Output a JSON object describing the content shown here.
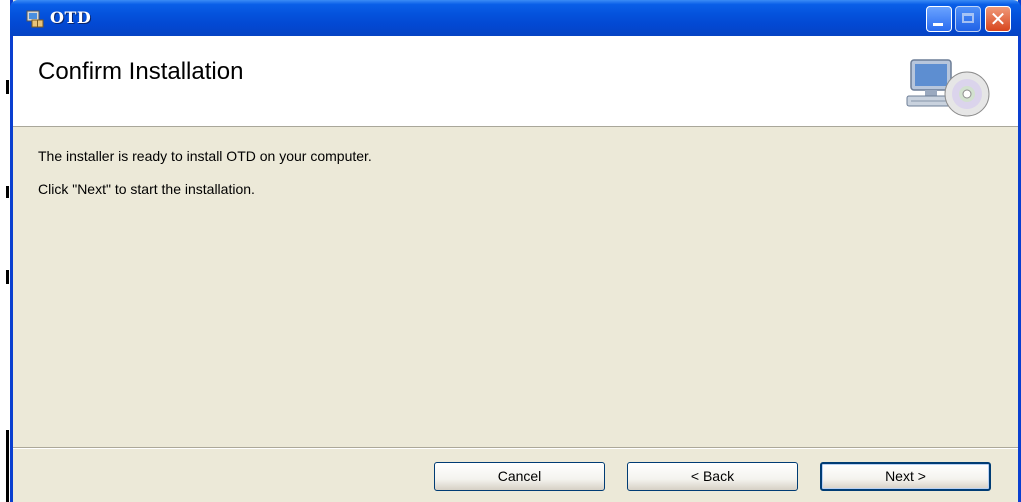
{
  "window": {
    "title": "OTD",
    "icon": "installer-package-icon",
    "controls": {
      "minimize_icon": "minimize-icon",
      "maximize_icon": "maximize-icon",
      "close_icon": "close-icon",
      "close_glyph": "✕"
    }
  },
  "header": {
    "title": "Confirm Installation",
    "icon": "computer-cd-icon"
  },
  "body": {
    "line1": "The installer is ready to install OTD on your computer.",
    "line2": "Click \"Next\" to start the installation."
  },
  "buttons": {
    "cancel": "Cancel",
    "back": "< Back",
    "next": "Next >"
  },
  "colors": {
    "titlebar": "#0452dc",
    "dialog_background": "#ece9d8",
    "header_background": "#ffffff",
    "button_border": "#003c74"
  }
}
